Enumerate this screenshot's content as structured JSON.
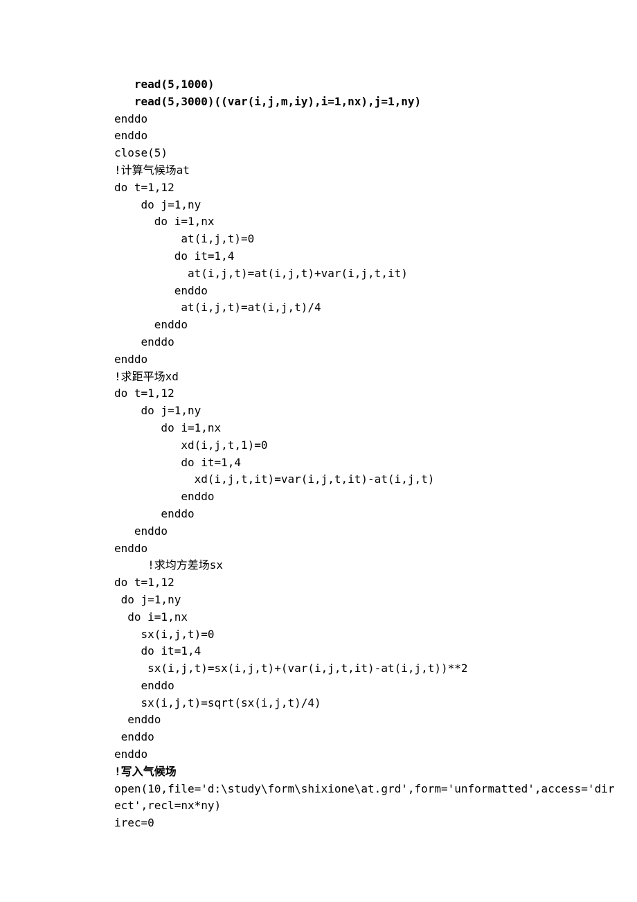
{
  "lines": [
    {
      "text": "   read(5,1000)",
      "bold": true
    },
    {
      "text": "   read(5,3000)((var(i,j,m,iy),i=1,nx),j=1,ny)",
      "bold": true
    },
    {
      "text": "enddo",
      "bold": false
    },
    {
      "text": "enddo",
      "bold": false
    },
    {
      "text": "close(5)",
      "bold": false
    },
    {
      "text": "!计算气候场at",
      "bold": false
    },
    {
      "text": "do t=1,12",
      "bold": false
    },
    {
      "text": "    do j=1,ny",
      "bold": false
    },
    {
      "text": "      do i=1,nx",
      "bold": false
    },
    {
      "text": "          at(i,j,t)=0",
      "bold": false
    },
    {
      "text": "         do it=1,4",
      "bold": false
    },
    {
      "text": "           at(i,j,t)=at(i,j,t)+var(i,j,t,it)",
      "bold": false
    },
    {
      "text": "         enddo",
      "bold": false
    },
    {
      "text": "          at(i,j,t)=at(i,j,t)/4",
      "bold": false
    },
    {
      "text": "      enddo",
      "bold": false
    },
    {
      "text": "    enddo",
      "bold": false
    },
    {
      "text": "enddo",
      "bold": false
    },
    {
      "text": "!求距平场xd",
      "bold": false
    },
    {
      "text": "do t=1,12",
      "bold": false
    },
    {
      "text": "    do j=1,ny",
      "bold": false
    },
    {
      "text": "       do i=1,nx",
      "bold": false
    },
    {
      "text": "          xd(i,j,t,1)=0",
      "bold": false
    },
    {
      "text": "          do it=1,4",
      "bold": false
    },
    {
      "text": "            xd(i,j,t,it)=var(i,j,t,it)-at(i,j,t)",
      "bold": false
    },
    {
      "text": "          enddo",
      "bold": false
    },
    {
      "text": "       enddo",
      "bold": false
    },
    {
      "text": "   enddo",
      "bold": false
    },
    {
      "text": "enddo",
      "bold": false
    },
    {
      "text": "     !求均方差场sx",
      "bold": false
    },
    {
      "text": "do t=1,12",
      "bold": false
    },
    {
      "text": " do j=1,ny",
      "bold": false
    },
    {
      "text": "  do i=1,nx",
      "bold": false
    },
    {
      "text": "    sx(i,j,t)=0",
      "bold": false
    },
    {
      "text": "    do it=1,4",
      "bold": false
    },
    {
      "text": "     sx(i,j,t)=sx(i,j,t)+(var(i,j,t,it)-at(i,j,t))**2",
      "bold": false
    },
    {
      "text": "    enddo",
      "bold": false
    },
    {
      "text": "    sx(i,j,t)=sqrt(sx(i,j,t)/4)",
      "bold": false
    },
    {
      "text": "  enddo",
      "bold": false
    },
    {
      "text": " enddo",
      "bold": false
    },
    {
      "text": "enddo",
      "bold": false
    },
    {
      "text": "!写入气候场",
      "bold": true
    },
    {
      "text": "open(10,file='d:\\study\\form\\shixione\\at.grd',form='unformatted',access='dir",
      "bold": false
    },
    {
      "text": "ect',recl=nx*ny)",
      "bold": false
    },
    {
      "text": "irec=0",
      "bold": false
    }
  ]
}
